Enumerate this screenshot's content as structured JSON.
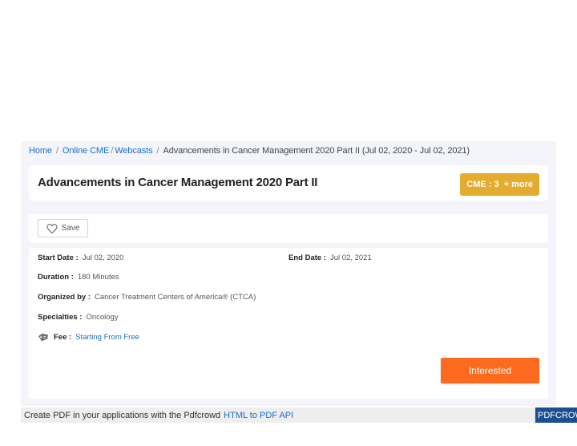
{
  "breadcrumb": {
    "home": "Home",
    "sep": "/",
    "online_cme": "Online CME",
    "webcasts": "Webcasts",
    "current": "Advancements in Cancer Management 2020 Part II (Jul 02, 2020 - Jul 02, 2021)"
  },
  "event": {
    "title": "Advancements in Cancer Management 2020 Part II",
    "cme_label": "CME : 3",
    "more_label": "+ more"
  },
  "actions": {
    "save_label": "Save",
    "interested_label": "Interested"
  },
  "details": {
    "start_date": {
      "label": "Start Date :",
      "value": "Jul 02, 2020"
    },
    "end_date": {
      "label": "End Date :",
      "value": "Jul 02, 2021"
    },
    "duration": {
      "label": "Duration :",
      "value": "180 Minutes"
    },
    "organized_by": {
      "label": "Organized by :",
      "value": "Cancer Treatment Centers of America® (CTCA)"
    },
    "specialties": {
      "label": "Specialties :",
      "value": "Oncology"
    },
    "fee": {
      "label": "Fee :",
      "value": "Starting From Free",
      "icon": "price-tag-icon"
    }
  },
  "footer": {
    "text": "Create PDF in your applications with the Pdfcrowd",
    "link": "HTML to PDF API",
    "tag": "PDFCROWD"
  },
  "colors": {
    "link": "#1a6dc4",
    "cme_badge": "#e3ac2e",
    "interested_button": "#fb6a1f",
    "panel_background": "#f3f5fb",
    "footer_tag": "#1c4f8f"
  }
}
